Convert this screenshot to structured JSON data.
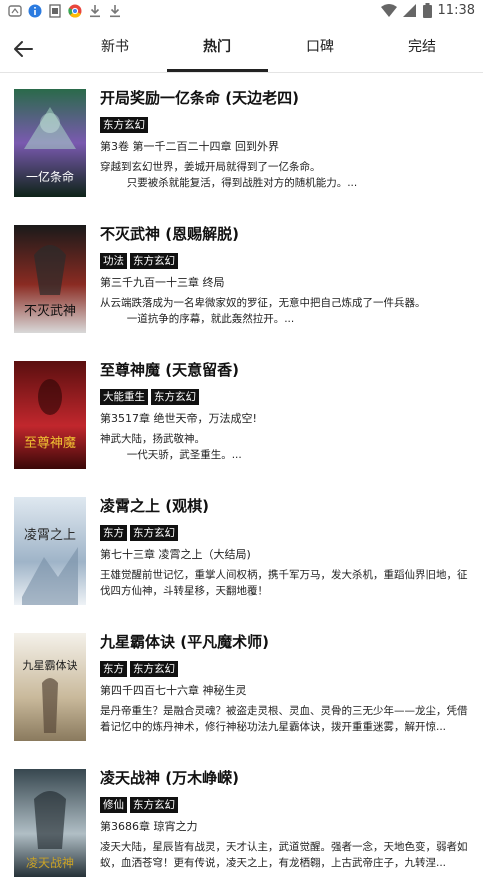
{
  "status_bar": {
    "time": "11:38",
    "left_icons": [
      "app-icon",
      "info-icon",
      "sim-icon",
      "chrome-icon",
      "download-icon",
      "download-icon"
    ],
    "right_icons": [
      "wifi-icon",
      "signal-icon",
      "battery-icon"
    ]
  },
  "tabs": [
    {
      "label": "新书",
      "active": false
    },
    {
      "label": "热门",
      "active": true
    },
    {
      "label": "口碑",
      "active": false
    },
    {
      "label": "完结",
      "active": false
    }
  ],
  "books": [
    {
      "title": "开局奖励一亿条命 (天边老四)",
      "tags": [
        "东方玄幻"
      ],
      "chapter": "第3卷 第一千二百二十四章 回到外界",
      "desc": "穿越到玄幻世界，姜城开局就得到了一亿条命。\n        只要被杀就能复活，得到战胜对方的随机能力。...",
      "cover_text": "一亿条命",
      "cover_colors": [
        "#2a6a4a",
        "#7a5ab0",
        "#0e2418"
      ]
    },
    {
      "title": "不灭武神 (恩赐解脱)",
      "tags": [
        "功法",
        "东方玄幻"
      ],
      "chapter": "第三千九百一十三章 终局",
      "desc": "从云端跌落成为一名卑微家奴的罗征，无意中把自己炼成了一件兵器。\n        一道抗争的序幕，就此轰然拉开。...",
      "cover_text": "不灭武神",
      "cover_colors": [
        "#1a1a1a",
        "#8a2b22",
        "#d9d9d9"
      ]
    },
    {
      "title": "至尊神魔 (天意留香)",
      "tags": [
        "大能重生",
        "东方玄幻"
      ],
      "chapter": "第3517章 绝世天帝，万法成空!",
      "desc": "神武大陆，扬武敬神。\n        一代天骄，武圣重生。...",
      "cover_text": "至尊神魔",
      "cover_colors": [
        "#5a0f0f",
        "#c1272d",
        "#f1c232"
      ]
    },
    {
      "title": "凌霄之上 (观棋)",
      "tags": [
        "东方",
        "东方玄幻"
      ],
      "chapter": "第七十三章 凌霄之上（大结局)",
      "desc": "王雄觉醒前世记忆，重掌人间权柄，携千军万马，发大杀机，重蹈仙界旧地，征伐四方仙神，斗转星移，天翻地覆！",
      "cover_text": "凌霄之上",
      "cover_colors": [
        "#dfe8f0",
        "#9fb4c8",
        "#2b2b2b"
      ]
    },
    {
      "title": "九星霸体诀 (平凡魔术师)",
      "tags": [
        "东方",
        "东方玄幻"
      ],
      "chapter": "第四千四百七十六章 神秘生灵",
      "desc": "是丹帝重生？是融合灵魂？被盗走灵根、灵血、灵骨的三无少年——龙尘，凭借着记忆中的炼丹神术，修行神秘功法九星霸体诀，拨开重重迷雾，解开惊...",
      "cover_text": "九星霸体诀",
      "cover_colors": [
        "#f4f1ea",
        "#c9b99b",
        "#1c1c1c"
      ]
    },
    {
      "title": "凌天战神 (万木峥嵘)",
      "tags": [
        "修仙",
        "东方玄幻"
      ],
      "chapter": "第3686章 琼宵之力",
      "desc": "凌天大陆，星辰皆有战灵，天才认主，武道觉醒。强者一念，天地色变，弱者如蚁，血洒苍穹！更有传说，凌天之上，有龙栖翱，上古武帝庄子，九转涅...",
      "cover_text": "凌天战神",
      "cover_colors": [
        "#37474f",
        "#b0bec5",
        "#c9a227"
      ]
    }
  ]
}
